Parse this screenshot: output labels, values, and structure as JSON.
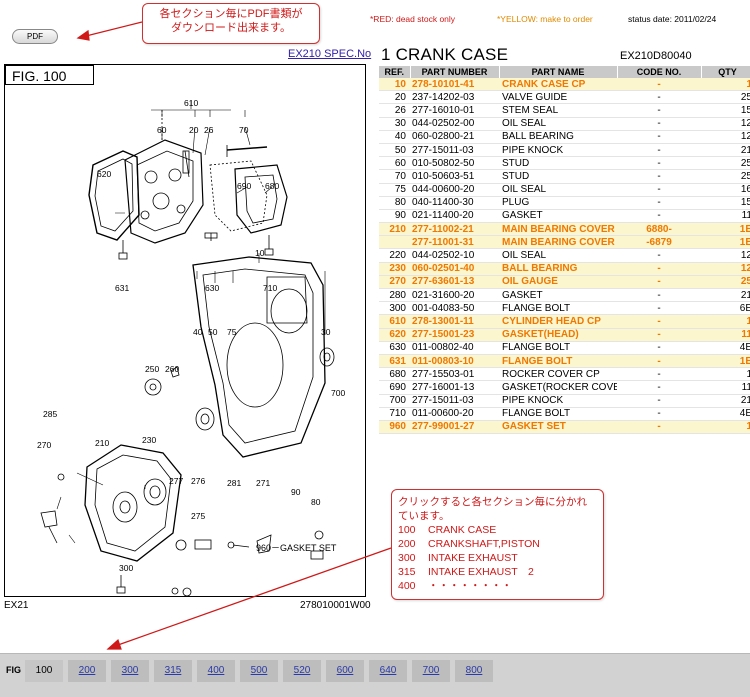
{
  "toolbar": {
    "pdf_label": "PDF"
  },
  "callout_top": {
    "line1": "各セクション毎にPDF書類が",
    "line2": "ダウンロード出来ます。"
  },
  "callout_bottom": {
    "line1": "クリックすると各セクション毎に分かれ",
    "line2": "ています。",
    "items": [
      {
        "num": "100",
        "label": "CRANK CASE"
      },
      {
        "num": "200",
        "label": "CRANKSHAFT,PISTON"
      },
      {
        "num": "300",
        "label": "INTAKE EXHAUST"
      },
      {
        "num": "315",
        "label": "INTAKE EXHAUST　2"
      },
      {
        "num": "400",
        "label": "・・・・・・・・"
      }
    ]
  },
  "legend": {
    "red": "*RED: dead stock only",
    "yellow": "*YELLOW: make to order",
    "status": "status date: 2011/02/24"
  },
  "header": {
    "spec_link": "EX210 SPEC.No",
    "section_title": "1 CRANK CASE",
    "model_code": "EX210D80040"
  },
  "figure": {
    "label": "FIG.  100",
    "footer_left": "EX21",
    "footer_right": "278010001W00",
    "gasket_note": "960－GASKET SET",
    "callouts": [
      "610",
      "60",
      "20",
      "26",
      "70",
      "620",
      "690",
      "680",
      "631",
      "630",
      "710",
      "10",
      "40",
      "50",
      "75",
      "30",
      "250",
      "260",
      "700",
      "285",
      "210",
      "270",
      "230",
      "277",
      "276",
      "281",
      "271",
      "90",
      "80",
      "275",
      "300"
    ]
  },
  "colors": {
    "orange": "#f07800",
    "yellow_row": "#fbf6cd",
    "header_gray": "#c9c9c9",
    "callout_red": "#d01818"
  },
  "table": {
    "headers": [
      "REF.",
      "PART NUMBER",
      "PART NAME",
      "CODE NO.",
      "QTY"
    ],
    "rows": [
      {
        "ref": "10",
        "pn": "278-10101-41",
        "name": "CRANK CASE CP",
        "code": "-",
        "qty": "1",
        "hl": true,
        "or": true
      },
      {
        "ref": "20",
        "pn": "237-14202-03",
        "name": "VALVE GUIDE",
        "code": "-",
        "qty": "25",
        "hl": false,
        "or": false
      },
      {
        "ref": "26",
        "pn": "277-16010-01",
        "name": "STEM SEAL",
        "code": "-",
        "qty": "15",
        "hl": false,
        "or": false
      },
      {
        "ref": "30",
        "pn": "044-02502-00",
        "name": "OIL SEAL",
        "code": "-",
        "qty": "12",
        "hl": false,
        "or": false
      },
      {
        "ref": "40",
        "pn": "060-02800-21",
        "name": "BALL BEARING",
        "code": "-",
        "qty": "12",
        "hl": false,
        "or": false
      },
      {
        "ref": "50",
        "pn": "277-15011-03",
        "name": "PIPE KNOCK",
        "code": "-",
        "qty": "21",
        "hl": false,
        "or": false
      },
      {
        "ref": "60",
        "pn": "010-50802-50",
        "name": "STUD",
        "code": "-",
        "qty": "25",
        "hl": false,
        "or": false
      },
      {
        "ref": "70",
        "pn": "010-50603-51",
        "name": "STUD",
        "code": "-",
        "qty": "25",
        "hl": false,
        "or": false
      },
      {
        "ref": "75",
        "pn": "044-00600-20",
        "name": "OIL SEAL",
        "code": "-",
        "qty": "16",
        "hl": false,
        "or": false
      },
      {
        "ref": "80",
        "pn": "040-11400-30",
        "name": "PLUG",
        "code": "-",
        "qty": "15",
        "hl": false,
        "or": false
      },
      {
        "ref": "90",
        "pn": "021-11400-20",
        "name": "GASKET",
        "code": "-",
        "qty": "11",
        "hl": false,
        "or": false
      },
      {
        "ref": "210",
        "pn": "277-11002-21",
        "name": "MAIN BEARING COVER C",
        "code": "6880-",
        "qty": "1E",
        "hl": true,
        "or": true
      },
      {
        "ref": "",
        "pn": "277-11001-31",
        "name": "MAIN BEARING COVER C",
        "code": "-6879",
        "qty": "1E",
        "hl": true,
        "or": true
      },
      {
        "ref": "220",
        "pn": "044-02502-10",
        "name": "OIL SEAL",
        "code": "-",
        "qty": "12",
        "hl": false,
        "or": false
      },
      {
        "ref": "230",
        "pn": "060-02501-40",
        "name": "BALL BEARING",
        "code": "-",
        "qty": "12",
        "hl": true,
        "or": true
      },
      {
        "ref": "270",
        "pn": "277-63601-13",
        "name": "OIL GAUGE",
        "code": "-",
        "qty": "25",
        "hl": true,
        "or": true
      },
      {
        "ref": "280",
        "pn": "021-31600-20",
        "name": "GASKET",
        "code": "-",
        "qty": "21",
        "hl": false,
        "or": false
      },
      {
        "ref": "300",
        "pn": "001-04083-50",
        "name": "FLANGE BOLT",
        "code": "-",
        "qty": "6E",
        "hl": false,
        "or": false
      },
      {
        "ref": "610",
        "pn": "278-13001-11",
        "name": "CYLINDER HEAD CP",
        "code": "-",
        "qty": "1",
        "hl": true,
        "or": true
      },
      {
        "ref": "620",
        "pn": "277-15001-23",
        "name": "GASKET(HEAD)",
        "code": "-",
        "qty": "11",
        "hl": true,
        "or": true
      },
      {
        "ref": "630",
        "pn": "011-00802-40",
        "name": "FLANGE BOLT",
        "code": "-",
        "qty": "4E",
        "hl": false,
        "or": false
      },
      {
        "ref": "631",
        "pn": "011-00803-10",
        "name": "FLANGE BOLT",
        "code": "-",
        "qty": "1E",
        "hl": true,
        "or": true
      },
      {
        "ref": "680",
        "pn": "277-15503-01",
        "name": "ROCKER COVER CP",
        "code": "-",
        "qty": "1",
        "hl": false,
        "or": false
      },
      {
        "ref": "690",
        "pn": "277-16001-13",
        "name": "GASKET(ROCKER COVER)",
        "code": "-",
        "qty": "11",
        "hl": false,
        "or": false
      },
      {
        "ref": "700",
        "pn": "277-15011-03",
        "name": "PIPE KNOCK",
        "code": "-",
        "qty": "21",
        "hl": false,
        "or": false
      },
      {
        "ref": "710",
        "pn": "011-00600-20",
        "name": "FLANGE BOLT",
        "code": "-",
        "qty": "4E",
        "hl": false,
        "or": false
      },
      {
        "ref": "960",
        "pn": "277-99001-27",
        "name": "GASKET SET",
        "code": "-",
        "qty": "1",
        "hl": true,
        "or": true
      }
    ]
  },
  "tabs": {
    "label": "FIG",
    "items": [
      {
        "label": "100",
        "current": true
      },
      {
        "label": "200",
        "current": false
      },
      {
        "label": "300",
        "current": false
      },
      {
        "label": "315",
        "current": false
      },
      {
        "label": "400",
        "current": false
      },
      {
        "label": "500",
        "current": false
      },
      {
        "label": "520",
        "current": false
      },
      {
        "label": "600",
        "current": false
      },
      {
        "label": "640",
        "current": false
      },
      {
        "label": "700",
        "current": false
      },
      {
        "label": "800",
        "current": false
      }
    ]
  }
}
